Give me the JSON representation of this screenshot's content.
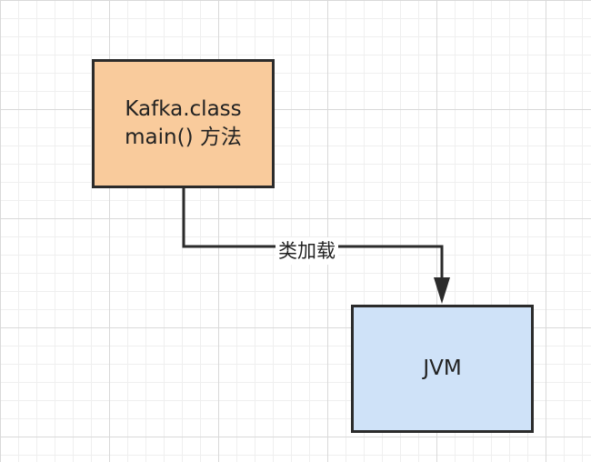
{
  "diagram": {
    "nodes": [
      {
        "id": "kafka",
        "lines": [
          "Kafka.class",
          "main() 方法"
        ],
        "fill": "#f9cb9c"
      },
      {
        "id": "jvm",
        "lines": [
          "JVM"
        ],
        "fill": "#cfe2f8"
      }
    ],
    "edges": [
      {
        "from": "kafka",
        "to": "jvm",
        "label": "类加载"
      }
    ],
    "colors": {
      "stroke": "#2b2b2b",
      "grid_major": "#d9d9d9",
      "grid_minor": "#efefef"
    }
  }
}
